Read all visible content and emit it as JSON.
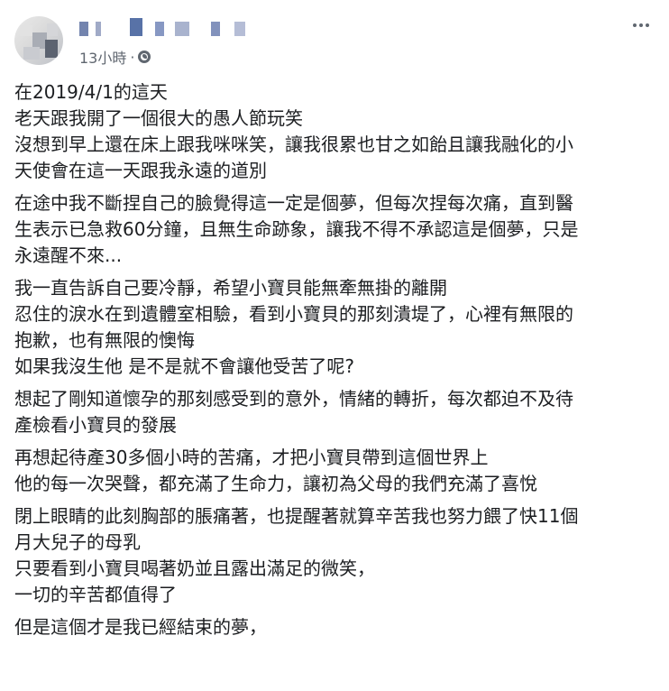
{
  "post": {
    "timestamp": "13小時",
    "separator": "·",
    "paragraphs": [
      {
        "lines": [
          "在2019/4/1的這天",
          "老天跟我開了一個很大的愚人節玩笑",
          "沒想到早上還在床上跟我咪咪笑，讓我很累也甘之如飴且讓我融化的小",
          "天使會在這一天跟我永遠的道別"
        ]
      },
      {
        "lines": [
          "在途中我不斷捏自己的臉覺得這一定是個夢，但每次捏每次痛，直到醫",
          "生表示已急救60分鐘，且無生命跡象，讓我不得不承認這是個夢，只是",
          "永遠醒不來..."
        ]
      },
      {
        "lines": [
          "我一直告訴自己要冷靜，希望小寶貝能無牽無掛的離開",
          "忍住的淚水在到遺體室相驗，看到小寶貝的那刻潰堤了，心裡有無限的",
          "抱歉，也有無限的懊悔",
          "如果我沒生他 是不是就不會讓他受苦了呢?"
        ]
      },
      {
        "lines": [
          "想起了剛知道懷孕的那刻感受到的意外，情緒的轉折，每次都迫不及待",
          "產檢看小寶貝的發展"
        ]
      },
      {
        "lines": [
          "再想起待產30多個小時的苦痛，才把小寶貝帶到這個世界上",
          "他的每一次哭聲，都充滿了生命力，讓初為父母的我們充滿了喜悅"
        ]
      },
      {
        "lines": [
          "閉上眼睛的此刻胸部的脹痛著，也提醒著就算辛苦我也努力餵了快11個",
          "月大兒子的母乳",
          "只要看到小寶貝喝著奶並且露出滿足的微笑，",
          "一切的辛苦都值得了"
        ]
      },
      {
        "lines": [
          "但是這個才是我已經結束的夢，"
        ]
      }
    ]
  },
  "icons": {
    "privacy": "globe-icon",
    "more": "more-options-icon"
  },
  "colors": {
    "text": "#1c1e21",
    "meta": "#606770",
    "background": "#ffffff"
  }
}
